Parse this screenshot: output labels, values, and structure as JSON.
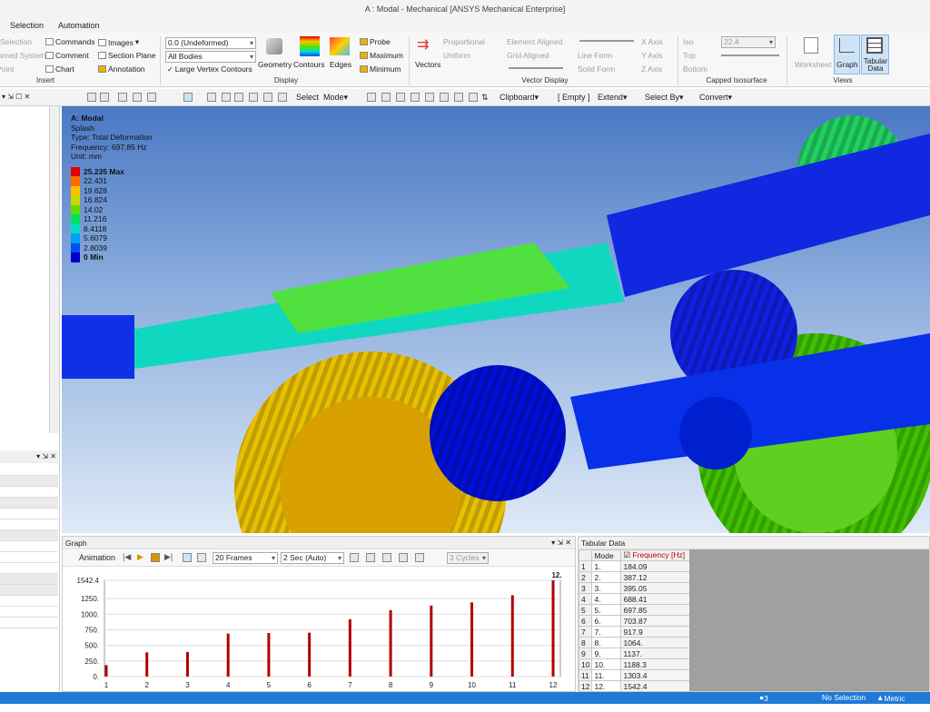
{
  "window": {
    "title": "A : Modal - Mechanical [ANSYS Mechanical Enterprise]"
  },
  "menu": [
    "Selection",
    "Automation"
  ],
  "ribbon": {
    "insert": {
      "label": "Insert",
      "items": [
        "Selection",
        "Named System",
        "Point",
        "Commands",
        "Comment",
        "Chart",
        "Images",
        "Section Plane",
        "Annotation"
      ]
    },
    "result_dropdown": "0.0 (Undeformed)",
    "bodies_dropdown": "All Bodies",
    "large_vertex_contours": "Large Vertex Contours",
    "display": {
      "label": "Display",
      "items": [
        "Geometry",
        "Contours",
        "Edges"
      ]
    },
    "probe": [
      "Probe",
      "Maximum",
      "Minimum"
    ],
    "vectors": "Vectors",
    "vector_display": {
      "label": "Vector Display",
      "items": [
        "Proportional",
        "Uniform",
        "Element Aligned",
        "Grid Aligned",
        "Line Form",
        "Solid Form",
        "X Axis",
        "Y Axis",
        "Z Axis"
      ]
    },
    "capped": {
      "label": "Capped Isosurface",
      "items": [
        "Iso",
        "Top",
        "Bottom"
      ],
      "value": "22.4"
    },
    "views": {
      "label": "Views",
      "items": [
        "Worksheet",
        "Graph",
        "Tabular Data"
      ]
    }
  },
  "toolbar": {
    "select": "Select",
    "mode": "Mode",
    "clipboard": "Clipboard",
    "empty": "[ Empty ]",
    "extend": "Extend",
    "select_by": "Select By",
    "convert": "Convert"
  },
  "viewport": {
    "info": [
      "A: Modal",
      "Splash",
      "Type: Total Deformation",
      "Frequency: 697.85 Hz",
      "Unit: mm"
    ],
    "legend": [
      {
        "label": "25.235 Max",
        "color": "#e00000"
      },
      {
        "label": "22.431",
        "color": "#ff6a00"
      },
      {
        "label": "19.628",
        "color": "#ffc000"
      },
      {
        "label": "16.824",
        "color": "#c8d800"
      },
      {
        "label": "14.02",
        "color": "#60e000"
      },
      {
        "label": "11.216",
        "color": "#00e060"
      },
      {
        "label": "8.4118",
        "color": "#00e0c8"
      },
      {
        "label": "5.6079",
        "color": "#00a0f0"
      },
      {
        "label": "2.8039",
        "color": "#0050f0"
      },
      {
        "label": "0 Min",
        "color": "#0000c8"
      }
    ]
  },
  "graph": {
    "title": "Graph",
    "animation": "Animation",
    "frames": "20 Frames",
    "duration": "2 Sec (Auto)",
    "cycles": "3 Cycles"
  },
  "chart_data": {
    "type": "bar",
    "categories": [
      "1",
      "2",
      "3",
      "4",
      "5",
      "6",
      "7",
      "8",
      "9",
      "10",
      "11",
      "12"
    ],
    "values": [
      184.09,
      387.12,
      395.05,
      688.41,
      697.85,
      703.87,
      917.9,
      1064,
      1137,
      1188.3,
      1303.4,
      1542.4
    ],
    "yticks": [
      "1542.4",
      "1250.",
      "1000.",
      "750.",
      "500.",
      "250.",
      "0."
    ],
    "ylim": [
      0,
      1542.4
    ],
    "highlight_label": "12.",
    "bar_color": "#b00000"
  },
  "tabular": {
    "title": "Tabular Data",
    "headers": [
      "Mode",
      "Frequency [Hz]"
    ],
    "rows": [
      [
        "1",
        "1.",
        "184.09"
      ],
      [
        "2",
        "2.",
        "387.12"
      ],
      [
        "3",
        "3.",
        "395.05"
      ],
      [
        "4",
        "4.",
        "688.41"
      ],
      [
        "5",
        "5.",
        "697.85"
      ],
      [
        "6",
        "6.",
        "703.87"
      ],
      [
        "7",
        "7.",
        "917.9"
      ],
      [
        "8",
        "8.",
        "1064."
      ],
      [
        "9",
        "9.",
        "1137."
      ],
      [
        "10",
        "10.",
        "1188.3"
      ],
      [
        "11",
        "11.",
        "1303.4"
      ],
      [
        "12",
        "12.",
        "1542.4"
      ]
    ]
  },
  "status": {
    "messages": "3 Messages",
    "selection": "No Selection",
    "units": "Metric (mm,"
  }
}
